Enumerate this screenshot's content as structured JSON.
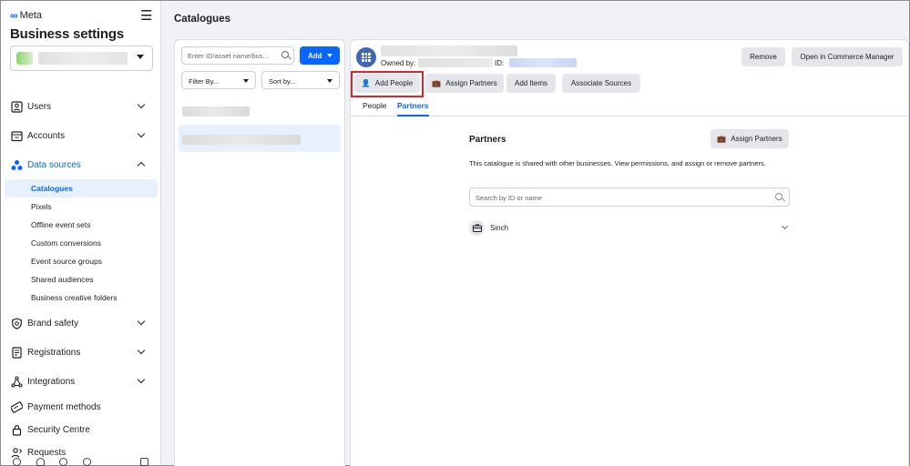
{
  "sidebar": {
    "brand": "Meta",
    "title": "Business settings",
    "nav": [
      {
        "label": "Users",
        "icon": "users-icon"
      },
      {
        "label": "Accounts",
        "icon": "accounts-icon"
      },
      {
        "label": "Data sources",
        "icon": "data-sources-icon"
      },
      {
        "label": "Brand safety",
        "icon": "shield-icon"
      },
      {
        "label": "Registrations",
        "icon": "registrations-icon"
      },
      {
        "label": "Integrations",
        "icon": "integrations-icon"
      },
      {
        "label": "Payment methods",
        "icon": "payment-icon"
      },
      {
        "label": "Security Centre",
        "icon": "lock-icon"
      },
      {
        "label": "Requests",
        "icon": "requests-icon"
      }
    ],
    "data_sources_sub": [
      "Catalogues",
      "Pixels",
      "Offline event sets",
      "Custom conversions",
      "Event source groups",
      "Shared audiences",
      "Business creative folders"
    ]
  },
  "header": {
    "title": "Catalogues"
  },
  "list_panel": {
    "search_placeholder": "Enter ID/asset name/bus...",
    "add_label": "Add",
    "filter_label": "Filter By...",
    "sort_label": "Sort by..."
  },
  "detail": {
    "owned_by_label": "Owned by:",
    "id_label": "ID:",
    "remove_label": "Remove",
    "open_commerce_label": "Open in Commerce Manager",
    "add_people_label": "Add People",
    "assign_partners_label": "Assign Partners",
    "add_items_label": "Add Items",
    "associate_sources_label": "Associate Sources",
    "tabs": [
      "People",
      "Partners"
    ],
    "active_tab": "Partners",
    "partners": {
      "title": "Partners",
      "assign_label": "Assign Partners",
      "description": "This catalogue is shared with other businesses. View permissions, and assign or remove partners.",
      "search_placeholder": "Search by ID or name",
      "items": [
        "Sinch"
      ]
    }
  },
  "colors": {
    "accent": "#0866ff",
    "highlight": "#e0222c",
    "selected_bg": "#e7f0fd"
  }
}
